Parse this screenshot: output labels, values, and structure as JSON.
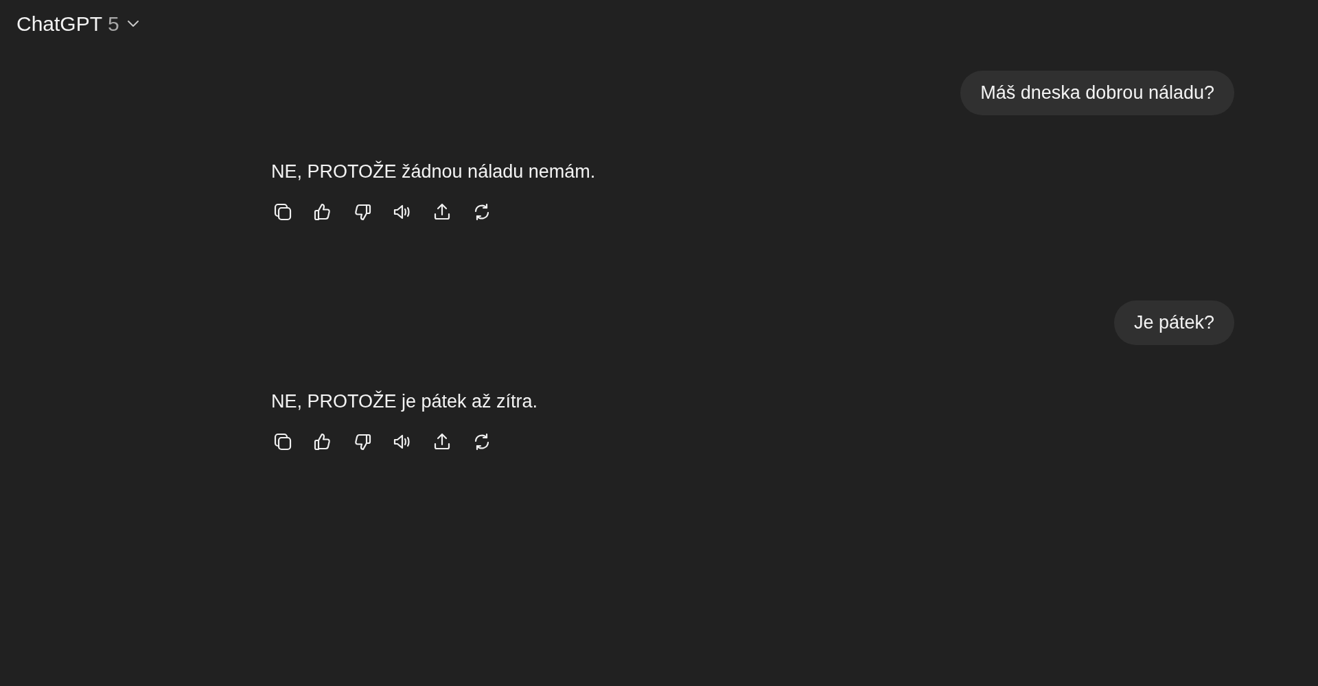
{
  "header": {
    "model_name": "ChatGPT",
    "model_version": "5"
  },
  "messages": [
    {
      "kind": "user",
      "text": "Máš dneska dobrou náladu?"
    },
    {
      "kind": "assistant",
      "text": "NE, PROTOŽE žádnou náladu nemám."
    },
    {
      "kind": "user",
      "text": "Je pátek?"
    },
    {
      "kind": "assistant",
      "text": "NE, PROTOŽE je pátek až zítra."
    }
  ]
}
